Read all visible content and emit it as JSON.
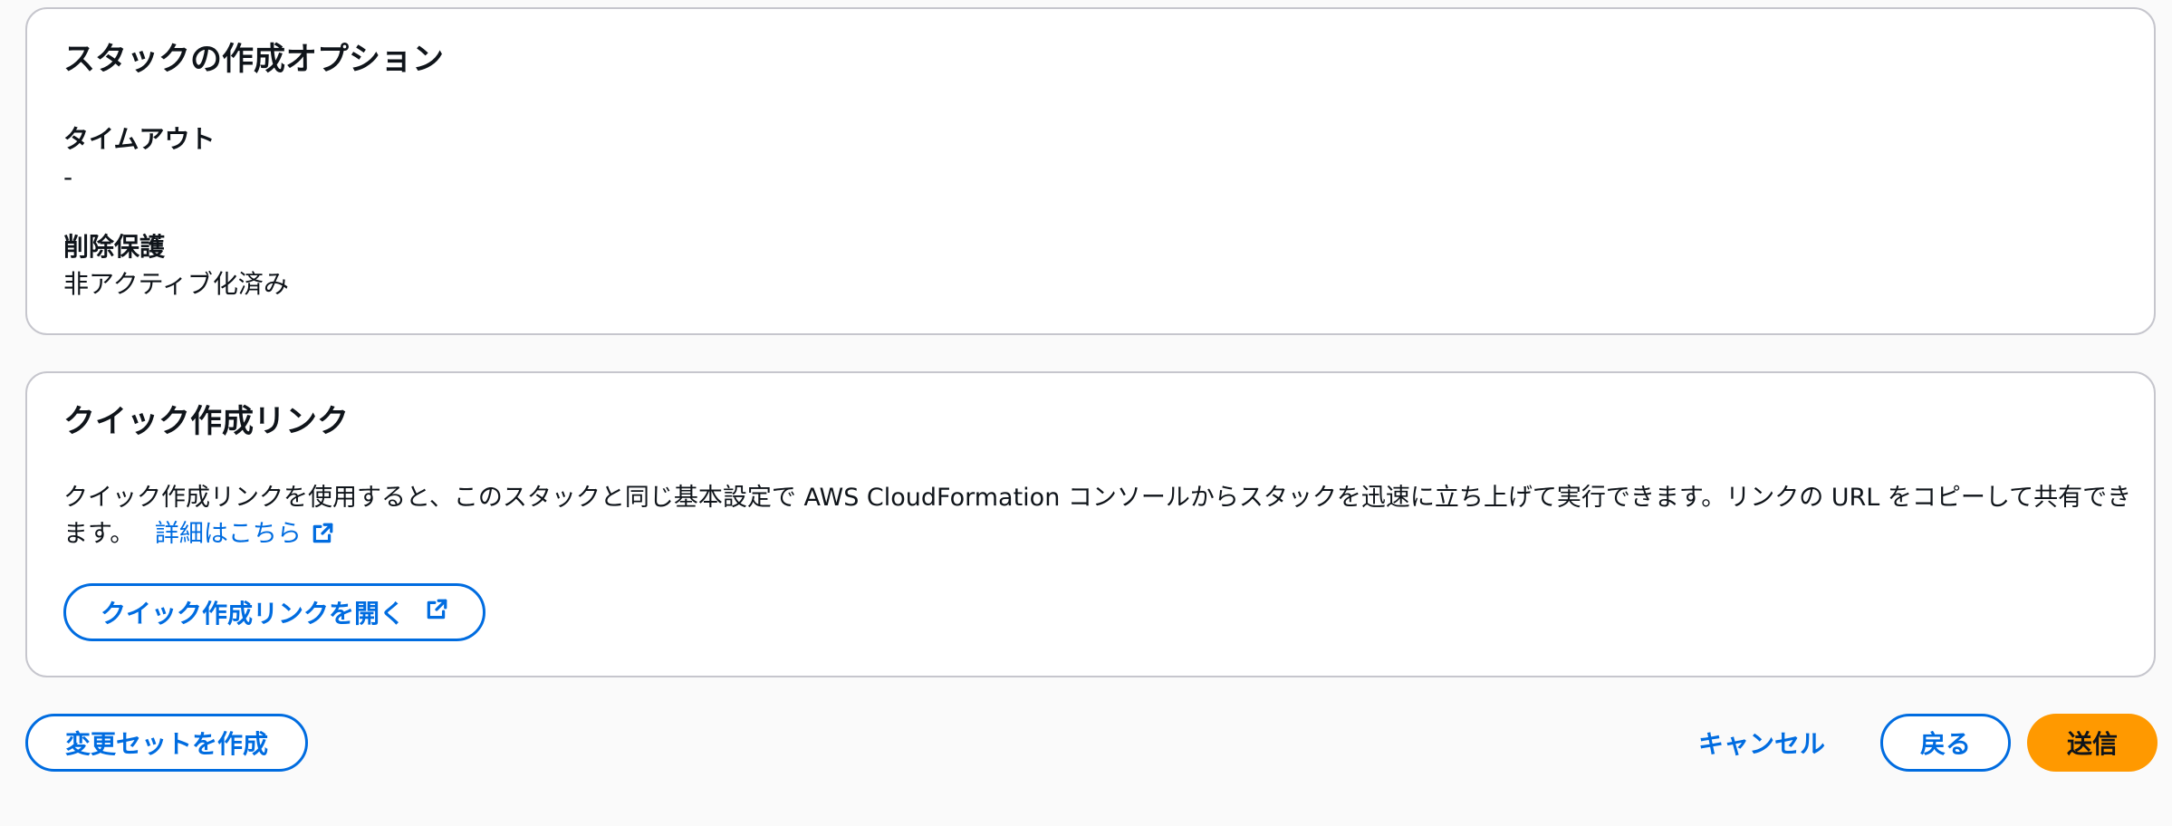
{
  "stack_options": {
    "title": "スタックの作成オプション",
    "timeout_label": "タイムアウト",
    "timeout_value": "-",
    "termination_protection_label": "削除保護",
    "termination_protection_value": "非アクティブ化済み"
  },
  "quick_create": {
    "title": "クイック作成リンク",
    "description": "クイック作成リンクを使用すると、このスタックと同じ基本設定で AWS CloudFormation コンソールからスタックを迅速に立ち上げて実行できます。リンクの URL をコピーして共有できます。",
    "learn_more": "詳細はこちら",
    "open_button": "クイック作成リンクを開く"
  },
  "footer": {
    "create_change_set": "変更セットを作成",
    "cancel": "キャンセル",
    "back": "戻る",
    "submit": "送信"
  },
  "colors": {
    "link": "#006ce0",
    "primary": "#ff9900",
    "border": "#c6c6cd"
  },
  "icons": [
    "external-link-icon"
  ]
}
